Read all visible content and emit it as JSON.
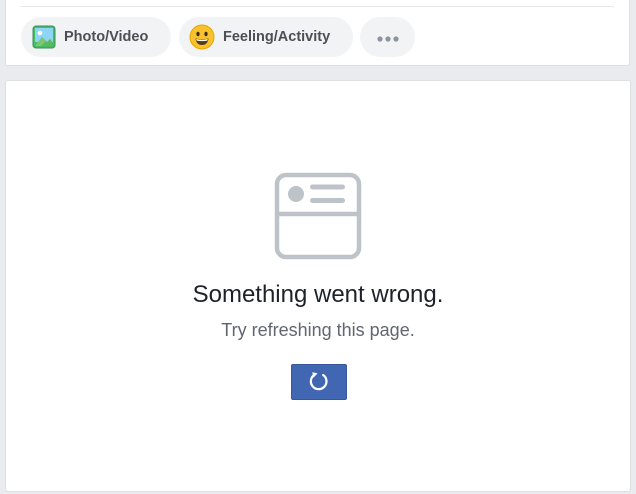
{
  "composer": {
    "actions": [
      {
        "label": "Photo/Video",
        "icon": "photo-icon"
      },
      {
        "label": "Feeling/Activity",
        "icon": "smiley-icon"
      },
      {
        "label": "",
        "icon": "more-dots-icon"
      }
    ]
  },
  "error_state": {
    "icon": "news-feed-placeholder-icon",
    "title": "Something went wrong.",
    "subtitle": "Try refreshing this page.",
    "refresh_button_icon": "refresh-icon"
  },
  "colors": {
    "page_background": "#e9ebee",
    "card_background": "#ffffff",
    "pill_background": "#f2f3f5",
    "refresh_button": "#4267b2",
    "illustration_gray": "#bec3c9",
    "title_text": "#1d2129",
    "subtitle_text": "#606770"
  }
}
